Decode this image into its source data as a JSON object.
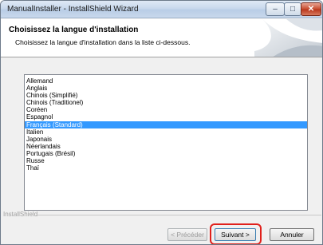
{
  "window": {
    "title": "ManualInstaller - InstallShield Wizard",
    "minimize_icon": "minimize-icon",
    "maximize_icon": "maximize-icon",
    "close_icon": "close-icon"
  },
  "header": {
    "title": "Choisissez la langue d'installation",
    "subtitle": "Choisissez la langue d'installation dans la liste ci-dessous."
  },
  "languages": {
    "items": [
      "Allemand",
      "Anglais",
      "Chinois (Simplifié)",
      "Chinois (Traditionel)",
      "Coréen",
      "Espagnol",
      "Français (Standard)",
      "Italien",
      "Japonais",
      "Néerlandais",
      "Portugais (Brésil)",
      "Russe",
      "Thaï"
    ],
    "selected": "Français (Standard)"
  },
  "footer": {
    "group_label": "InstallShield",
    "back_label": "< Précéder",
    "next_label": "Suivant >",
    "cancel_label": "Annuler"
  },
  "colors": {
    "selection": "#3399ff",
    "highlight_ring": "#e0201b"
  }
}
